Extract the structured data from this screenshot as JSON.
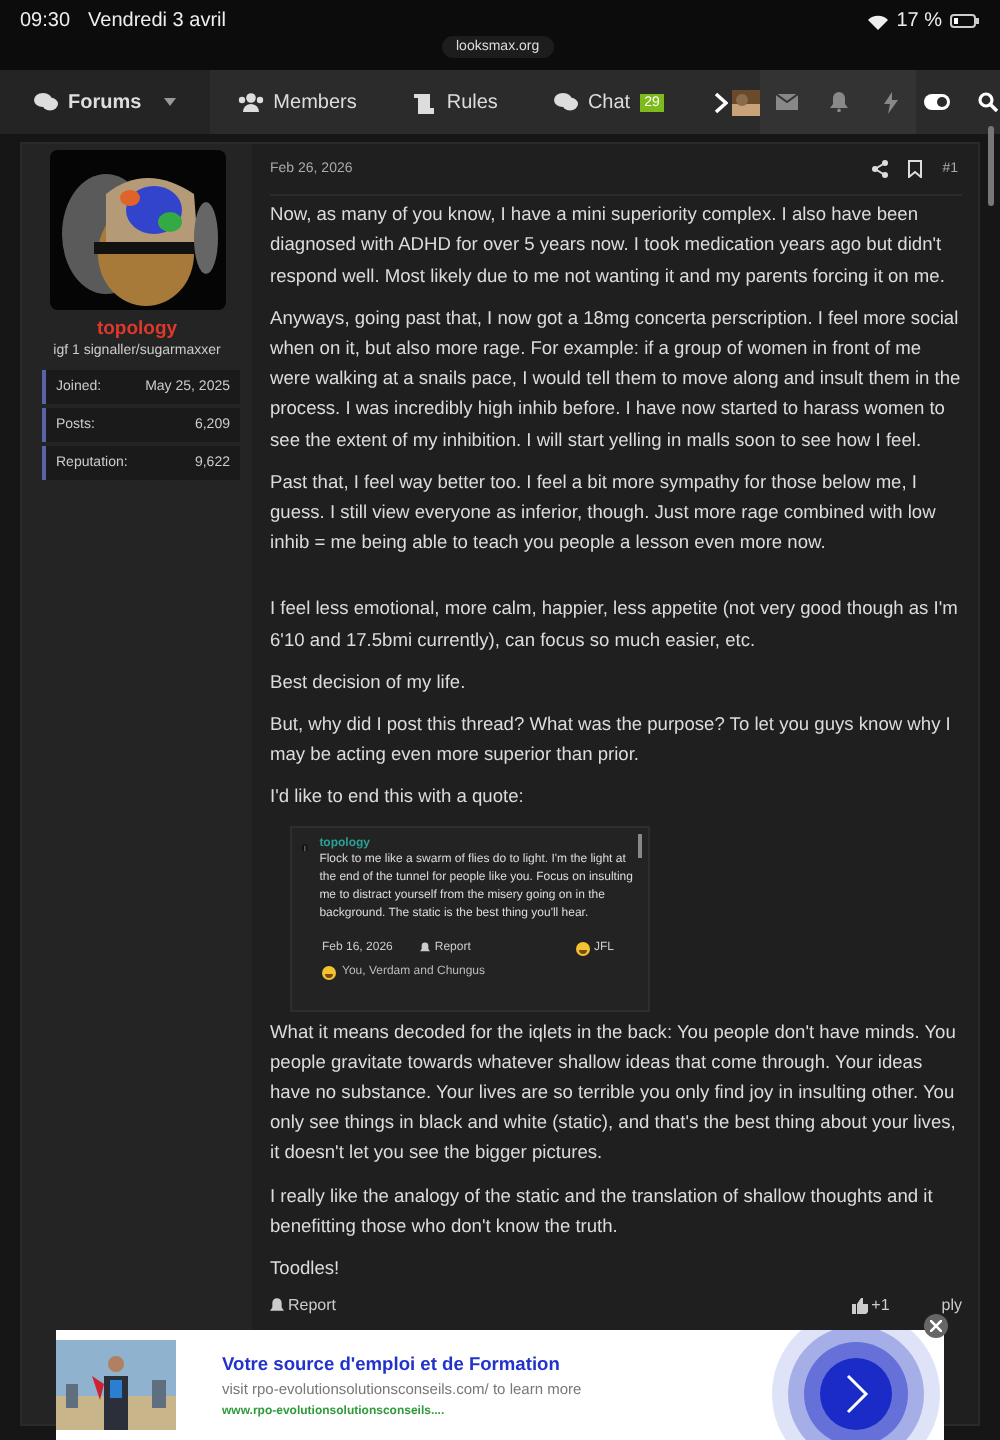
{
  "status_bar": {
    "time": "09:30",
    "date": "Vendredi 3 avril",
    "battery": "17 %"
  },
  "browser": {
    "url": "looksmax.org"
  },
  "nav": {
    "items": [
      {
        "label": "Forums",
        "selected": true,
        "dropdown": true
      },
      {
        "label": "Members",
        "selected": false,
        "dropdown": false
      },
      {
        "label": "Rules",
        "selected": false,
        "dropdown": false
      },
      {
        "label": "Chat",
        "selected": false,
        "dropdown": false,
        "badge": "29"
      }
    ]
  },
  "user": {
    "name": "topology",
    "title": "igf 1 signaller/sugarmaxxer",
    "stats": [
      {
        "label": "Joined:",
        "value": "May 25, 2025"
      },
      {
        "label": "Posts:",
        "value": "6,209"
      },
      {
        "label": "Reputation:",
        "value": "9,622"
      }
    ]
  },
  "post": {
    "date": "Feb 26, 2026",
    "number": "#1",
    "blocks": [
      {
        "kind": "text",
        "text": "Now, as many of you know, I have a mini superiority complex. I also have been diagnosed with ADHD for over 5 years now. I took medication years ago but didn't respond well. Most likely due to me not wanting it and my parents forcing it on me."
      },
      {
        "kind": "text",
        "text": "Anyways, going past that, I now got a 18mg concerta perscription. I feel more social when on it, but also more rage. For example: if a group of women in front of me were walking at a snails pace, I would tell them to move along and insult them in the process. I was incredibly high inhib before. I have now started to harass women to see the extent of my inhibition. I will start yelling in malls soon to see how I feel."
      },
      {
        "kind": "text",
        "text": "Past that, I feel way better too. I feel a bit more sympathy for those below me, I guess. I still view everyone as inferior, though. Just more rage combined with low inhib = me being able to teach you people a lesson even more now."
      },
      {
        "kind": "text",
        "text": "I feel less emotional, more calm, happier, less appetite (not very good though as I'm 6'10 and 17.5bmi currently), can focus so much easier, etc."
      },
      {
        "kind": "text",
        "text": "Best decision of my life."
      },
      {
        "kind": "text",
        "text": "But, why did I post this thread? What was the purpose? To let you guys know why I may be acting even more superior than prior."
      },
      {
        "kind": "text",
        "text": "I'd like to end this with a quote:"
      },
      {
        "kind": "quote",
        "author": "topology",
        "text": "Flock to me like a swarm of flies do to light. I'm the light at the end of the tunnel for people like you. Focus on insulting me to distract yourself from the misery going on in the background. The static is the best thing you'll hear.",
        "date": "Feb 16, 2026",
        "report": "Report",
        "reaction": "JFL",
        "reactors": "You, Verdam and Chungus"
      },
      {
        "kind": "text",
        "text": "What it means decoded for the iqlets in the back: You people don't have minds. You people gravitate towards whatever shallow ideas that come through. Your ideas have no substance. Your lives are so terrible you only find joy in insulting other. You only see things in black and white (static), and that's the best thing about your lives, it doesn't let you see the bigger pictures."
      },
      {
        "kind": "text",
        "text": "I really like the analogy of the static and the translation of shallow thoughts and it benefitting those who don't know the truth."
      },
      {
        "kind": "text",
        "text": "Toodles!"
      }
    ],
    "report": "Report",
    "likes": "+1",
    "reply": "ply"
  },
  "ad": {
    "title": "Votre source d'emploi et de Formation",
    "text": "visit rpo-evolutionsolutionsconseils.com/ to learn more",
    "url": "www.rpo-evolutionsolutionsconseils...."
  }
}
